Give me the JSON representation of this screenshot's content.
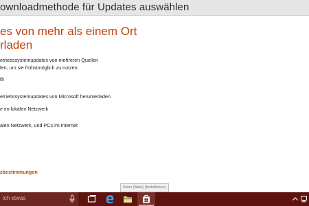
{
  "window": {
    "title": "ownloadmethode für Updates auswählen"
  },
  "content": {
    "heading_line1": "es von mehr als einem Ort",
    "heading_line2": "rladen",
    "description_line1": "etriebssystemupdates von mehreren Quellen",
    "description_line2": "len, um sie frühstmöglich zu nutzen.",
    "toggle_label": "n",
    "option1": "etriebssystemupdates von Microsoft herunterladen",
    "option2": "e im lokalen Netzwerk",
    "option3": "alen Netzwerk, und PCs im Internet",
    "privacy_link": "zbestimmungen"
  },
  "tooltip": "Store (Beta) (Installieren)",
  "taskbar": {
    "search_placeholder": "ich etwas",
    "icons": [
      "task-view-icon",
      "edge-icon",
      "file-explorer-icon",
      "store-icon"
    ],
    "tray": [
      "chevron-up-icon",
      "network-icon"
    ],
    "colors": {
      "taskbar": "#5e130f",
      "search": "#6e2622",
      "accent": "#c1410a"
    }
  }
}
